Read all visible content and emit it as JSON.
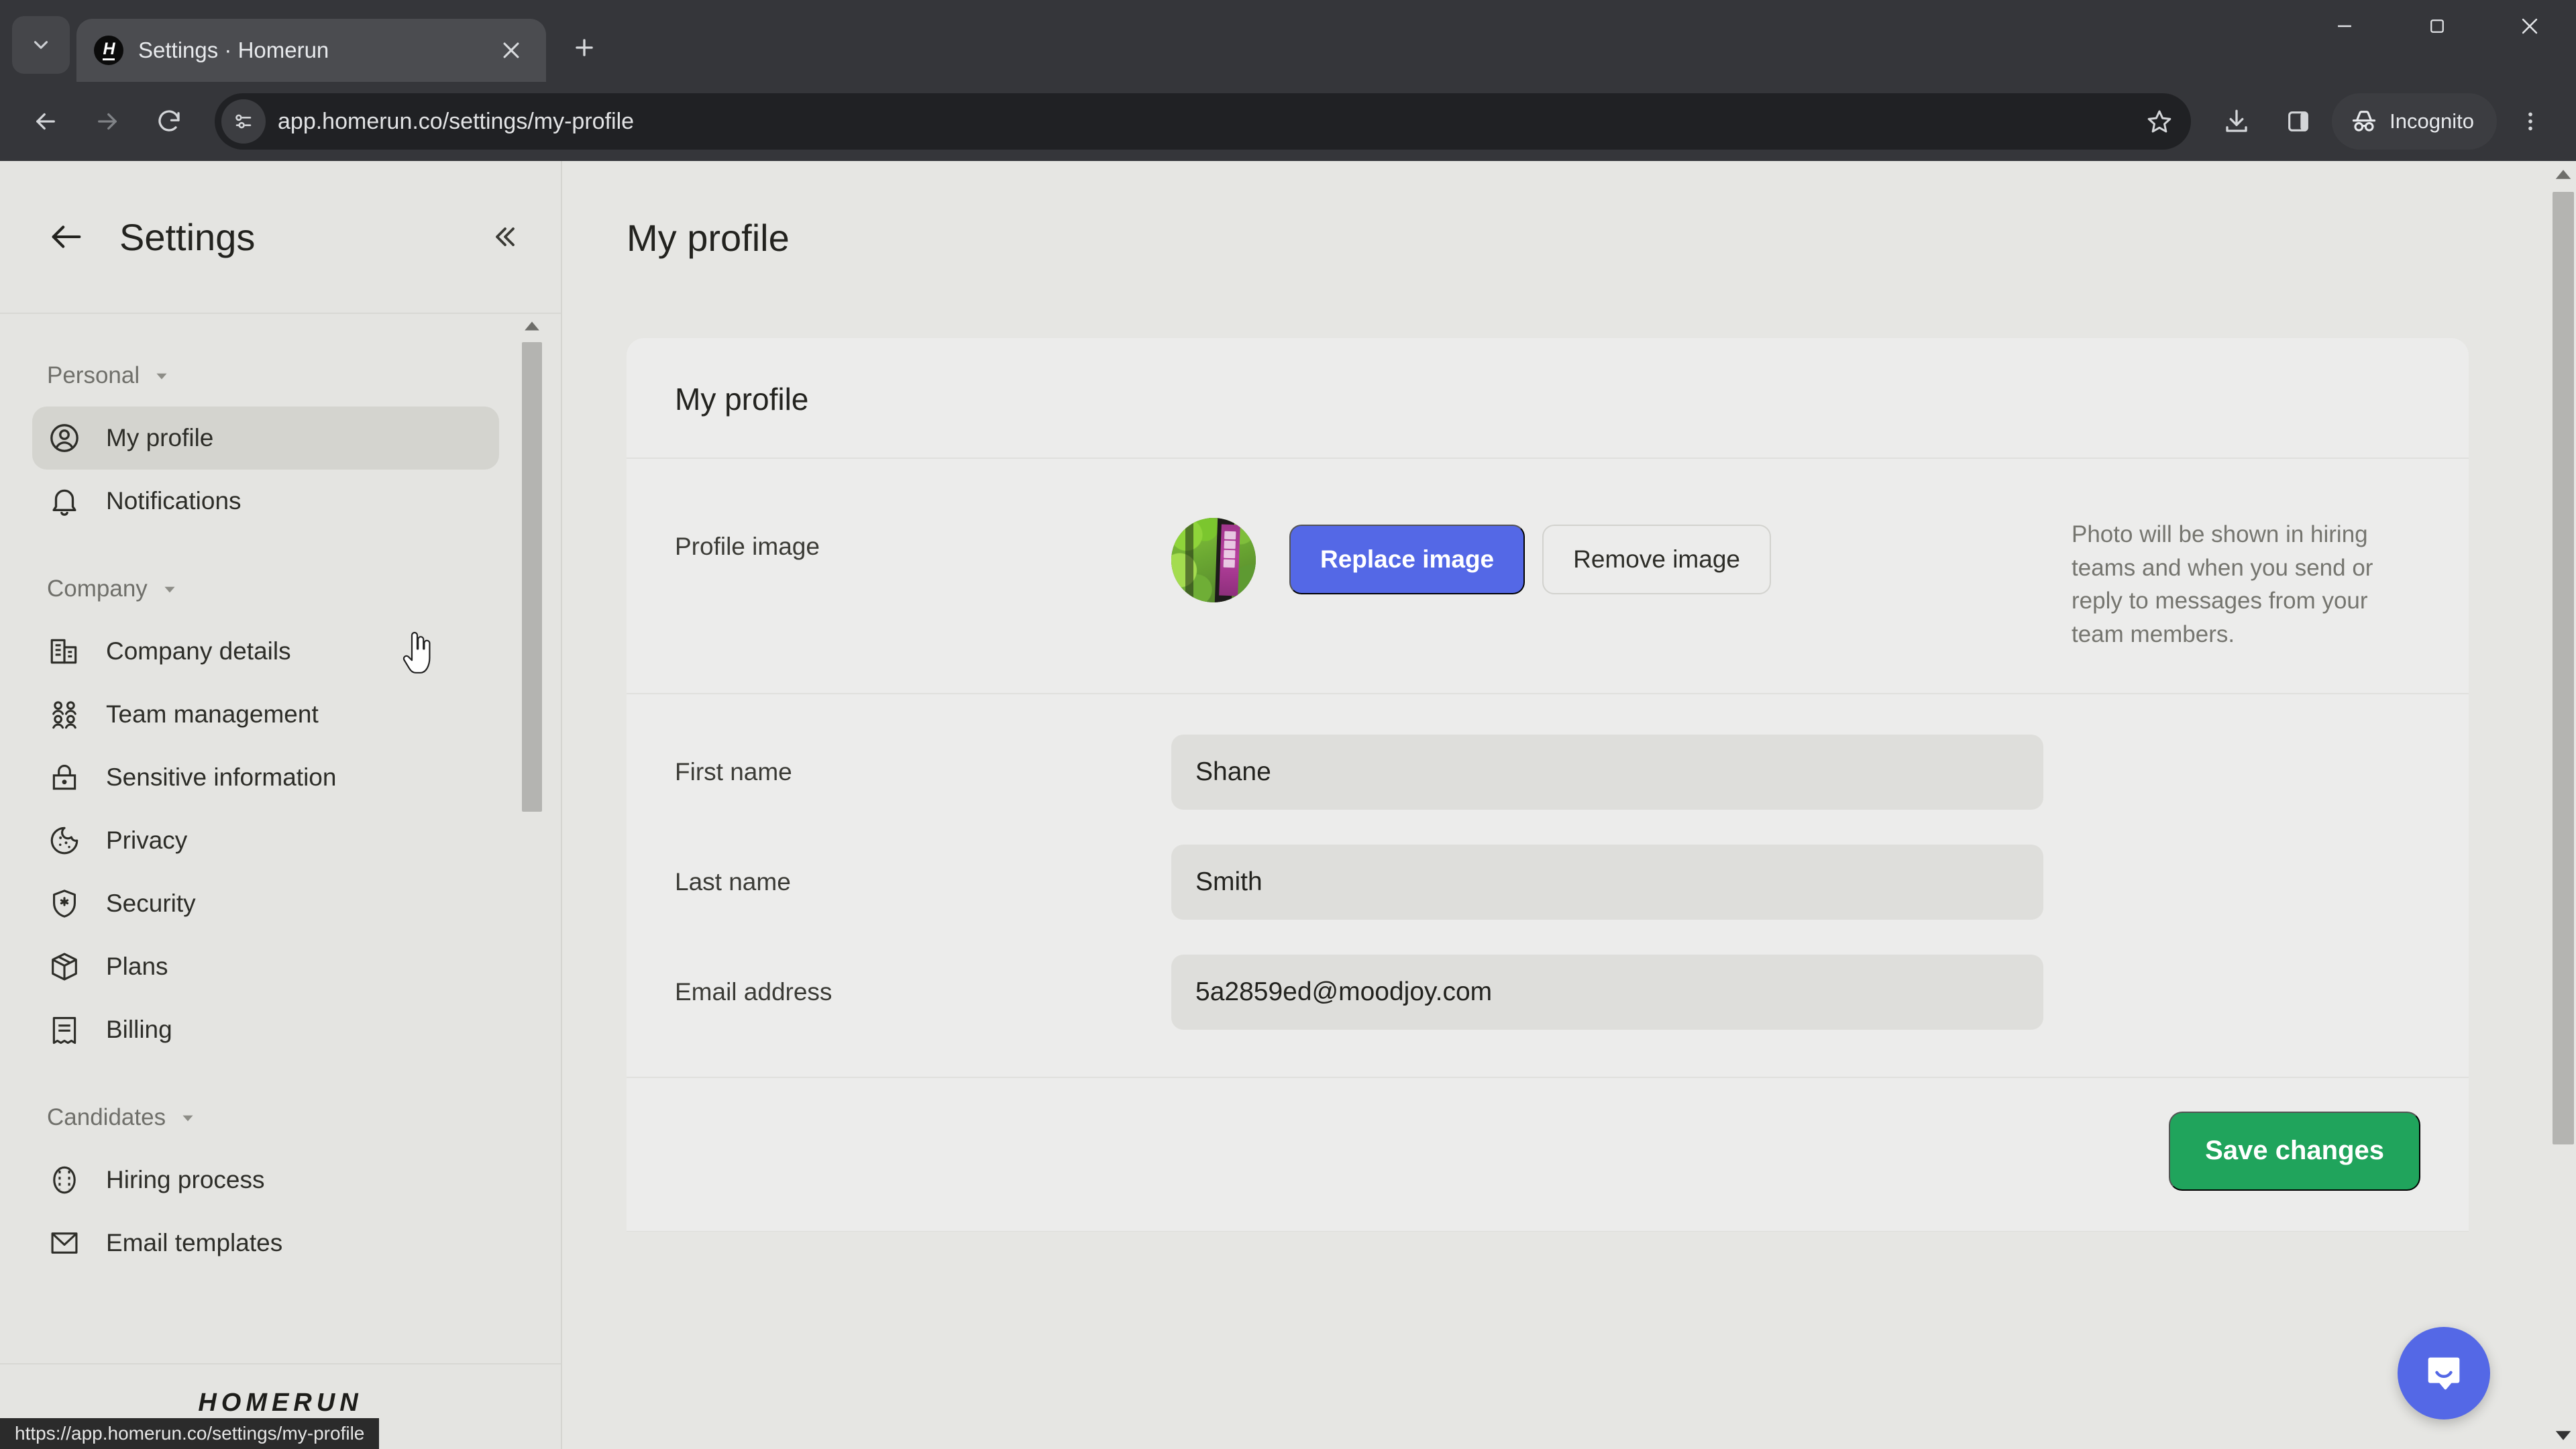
{
  "browser": {
    "tab": {
      "title": "Settings · Homerun",
      "favicon_letter": "H",
      "favicon_name": "homerun-favicon"
    },
    "tab_search_name": "tab-search-icon",
    "new_tab_label": "+",
    "window_controls": [
      "minimize",
      "maximize",
      "close"
    ],
    "omnibox": {
      "url": "app.homerun.co/settings/my-profile",
      "site_info_icon": "page-info-icon"
    },
    "toolbar_icons": [
      "back-icon",
      "forward-icon",
      "reload-icon",
      "bookmark-star-icon",
      "download-icon",
      "side-panel-icon",
      "browser-menu-icon"
    ],
    "incognito_label": "Incognito",
    "status_bar_url": "https://app.homerun.co/settings/my-profile"
  },
  "sidebar": {
    "title": "Settings",
    "back_icon": "arrow-left-icon",
    "collapse_icon": "chevron-double-left-icon",
    "groups": [
      {
        "label": "Personal",
        "items": [
          {
            "label": "My profile",
            "icon": "user-circle-icon",
            "active": true
          },
          {
            "label": "Notifications",
            "icon": "bell-icon",
            "active": false
          }
        ]
      },
      {
        "label": "Company",
        "items": [
          {
            "label": "Company details",
            "icon": "building-icon",
            "active": false
          },
          {
            "label": "Team management",
            "icon": "users-icon",
            "active": false
          },
          {
            "label": "Sensitive information",
            "icon": "lock-icon",
            "active": false
          },
          {
            "label": "Privacy",
            "icon": "cookie-icon",
            "active": false
          },
          {
            "label": "Security",
            "icon": "shield-star-icon",
            "active": false
          },
          {
            "label": "Plans",
            "icon": "box-icon",
            "active": false
          },
          {
            "label": "Billing",
            "icon": "receipt-icon",
            "active": false
          }
        ]
      },
      {
        "label": "Candidates",
        "items": [
          {
            "label": "Hiring process",
            "icon": "pipeline-icon",
            "active": false
          },
          {
            "label": "Email templates",
            "icon": "envelope-icon",
            "active": false
          }
        ]
      }
    ],
    "logo": "HOMERUN"
  },
  "main": {
    "page_title": "My profile",
    "card": {
      "heading": "My profile",
      "profile_image": {
        "label": "Profile image",
        "replace_button": "Replace image",
        "remove_button": "Remove image",
        "helper_text": "Photo will be shown in hiring teams and when you send or reply to messages from your team members."
      },
      "fields": [
        {
          "label": "First name",
          "value": "Shane",
          "name": "first-name-input"
        },
        {
          "label": "Last name",
          "value": "Smith",
          "name": "last-name-input"
        },
        {
          "label": "Email address",
          "value": "5a2859ed@moodjoy.com",
          "name": "email-address-input"
        }
      ],
      "save_button": "Save changes"
    },
    "chat_widget_icon": "intercom-chat-icon"
  },
  "colors": {
    "accent_blue": "#5468e6",
    "success_green": "#20a45c",
    "page_bg": "#e6e6e3",
    "card_bg": "#ececeb",
    "input_bg": "#dededb",
    "chrome_bg": "#35363a"
  }
}
